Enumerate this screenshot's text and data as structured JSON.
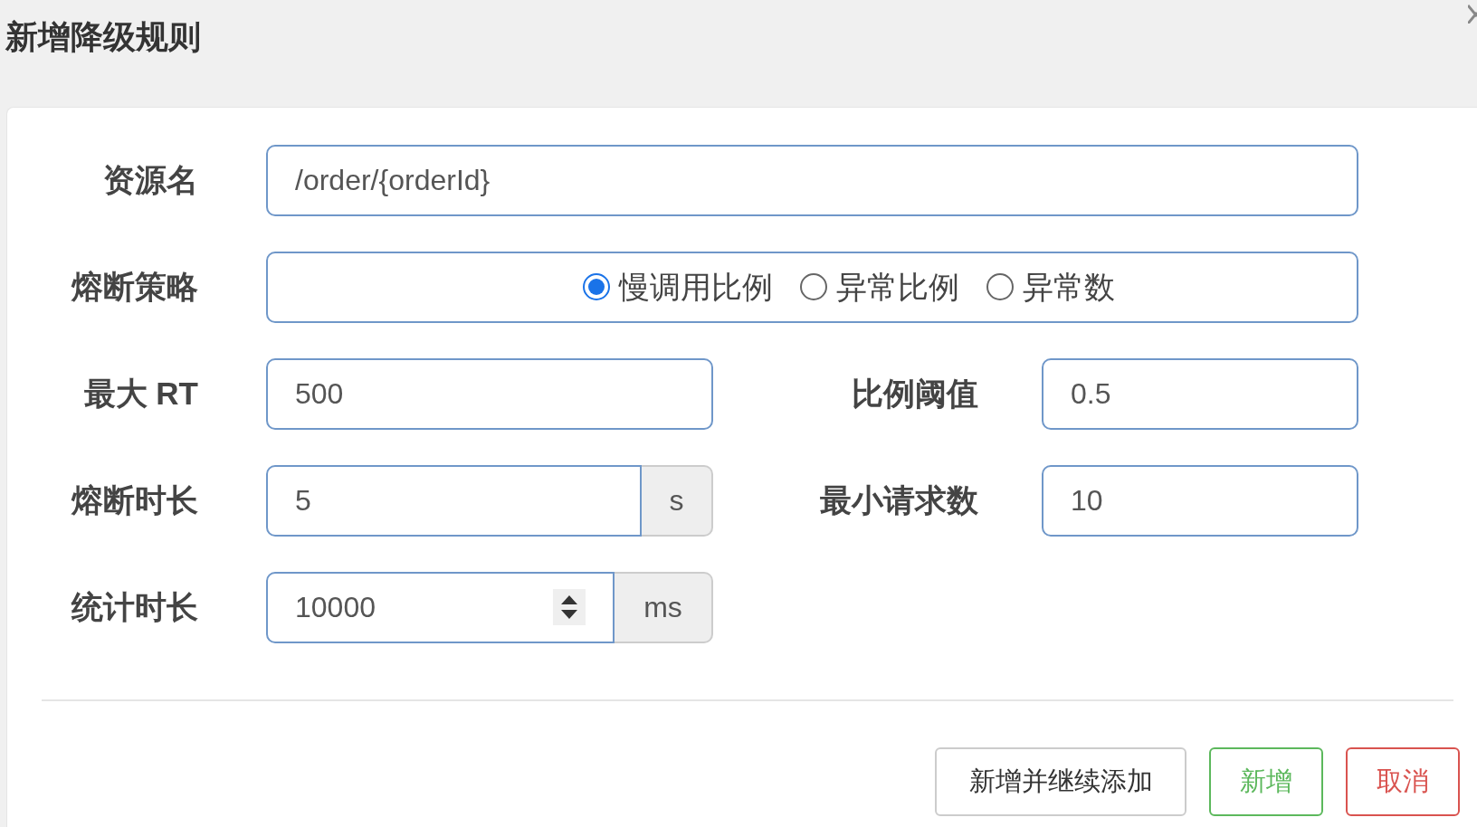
{
  "dialog": {
    "title": "新增降级规则"
  },
  "resource": {
    "label": "资源名",
    "value": "/order/{orderId}"
  },
  "strategy": {
    "label": "熔断策略",
    "options": [
      {
        "label": "慢调用比例",
        "selected": true
      },
      {
        "label": "异常比例",
        "selected": false
      },
      {
        "label": "异常数",
        "selected": false
      }
    ]
  },
  "max_rt": {
    "label": "最大 RT",
    "value": "500"
  },
  "ratio_threshold": {
    "label": "比例阈值",
    "value": "0.5"
  },
  "break_duration": {
    "label": "熔断时长",
    "value": "5",
    "unit": "s"
  },
  "min_requests": {
    "label": "最小请求数",
    "value": "10"
  },
  "stat_duration": {
    "label": "统计时长",
    "value": "10000",
    "unit": "ms"
  },
  "buttons": [
    {
      "label": "新增并继续添加",
      "kind": "default"
    },
    {
      "label": "新增",
      "kind": "success"
    },
    {
      "label": "取消",
      "kind": "danger"
    }
  ]
}
